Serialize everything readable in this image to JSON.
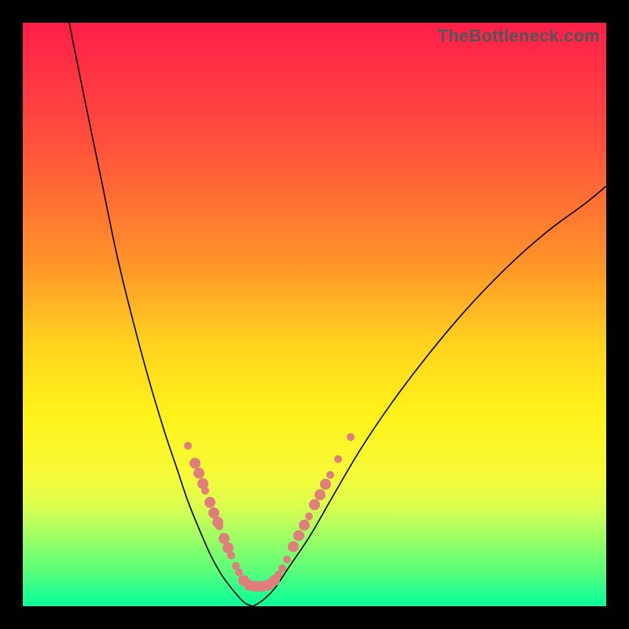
{
  "watermark": "TheBottleneck.com",
  "colors": {
    "background": "#000000",
    "curve": "#000000",
    "marker": "#e07d7d"
  },
  "chart_data": {
    "type": "line",
    "title": "",
    "xlabel": "",
    "ylabel": "",
    "xlim": [
      0,
      742
    ],
    "ylim_visual_percent_from_top": [
      0,
      100
    ],
    "series": [
      {
        "name": "left-branch",
        "x": [
          59,
          80,
          100,
          120,
          140,
          160,
          180,
          195,
          210,
          225,
          238,
          250,
          260,
          272,
          283,
          293
        ],
        "y_percent_from_top": [
          0,
          14,
          27,
          40,
          51,
          61,
          70,
          76,
          82,
          87,
          91,
          94,
          96,
          98,
          99.5,
          100
        ]
      },
      {
        "name": "right-branch",
        "x": [
          293,
          305,
          320,
          340,
          365,
          395,
          430,
          470,
          515,
          565,
          615,
          665,
          715,
          742
        ],
        "y_percent_from_top": [
          100,
          99,
          97,
          93,
          88,
          81,
          73,
          65,
          57,
          49,
          42,
          36,
          31,
          28
        ]
      }
    ],
    "markers": [
      {
        "x": 210,
        "y_percent_from_top": 72.5,
        "r": 5
      },
      {
        "x": 219,
        "y_percent_from_top": 75.5,
        "r": 7
      },
      {
        "x": 224,
        "y_percent_from_top": 77.2,
        "r": 7
      },
      {
        "x": 229,
        "y_percent_from_top": 79.0,
        "r": 7
      },
      {
        "x": 232,
        "y_percent_from_top": 80.2,
        "r": 5
      },
      {
        "x": 238,
        "y_percent_from_top": 82.2,
        "r": 7
      },
      {
        "x": 243,
        "y_percent_from_top": 84.0,
        "r": 7
      },
      {
        "x": 248,
        "y_percent_from_top": 85.6,
        "r": 7
      },
      {
        "x": 250,
        "y_percent_from_top": 86.3,
        "r": 5
      },
      {
        "x": 256,
        "y_percent_from_top": 88.4,
        "r": 7
      },
      {
        "x": 261,
        "y_percent_from_top": 90.0,
        "r": 7
      },
      {
        "x": 265,
        "y_percent_from_top": 91.3,
        "r": 5
      },
      {
        "x": 271,
        "y_percent_from_top": 93.1,
        "r": 5
      },
      {
        "x": 275,
        "y_percent_from_top": 94.2,
        "r": 5
      },
      {
        "x": 281,
        "y_percent_from_top": 95.6,
        "r": 7
      },
      {
        "x": 288,
        "y_percent_from_top": 96.4,
        "r": 7
      },
      {
        "x": 296,
        "y_percent_from_top": 96.6,
        "r": 7
      },
      {
        "x": 304,
        "y_percent_from_top": 96.6,
        "r": 7
      },
      {
        "x": 312,
        "y_percent_from_top": 96.4,
        "r": 7
      },
      {
        "x": 320,
        "y_percent_from_top": 95.6,
        "r": 7
      },
      {
        "x": 325,
        "y_percent_from_top": 94.6,
        "r": 5
      },
      {
        "x": 330,
        "y_percent_from_top": 93.5,
        "r": 5
      },
      {
        "x": 336,
        "y_percent_from_top": 92.0,
        "r": 5
      },
      {
        "x": 344,
        "y_percent_from_top": 89.8,
        "r": 7
      },
      {
        "x": 351,
        "y_percent_from_top": 87.9,
        "r": 7
      },
      {
        "x": 358,
        "y_percent_from_top": 86.1,
        "r": 7
      },
      {
        "x": 364,
        "y_percent_from_top": 84.6,
        "r": 5
      },
      {
        "x": 371,
        "y_percent_from_top": 82.6,
        "r": 7
      },
      {
        "x": 378,
        "y_percent_from_top": 80.9,
        "r": 7
      },
      {
        "x": 385,
        "y_percent_from_top": 79.1,
        "r": 7
      },
      {
        "x": 391,
        "y_percent_from_top": 77.5,
        "r": 5
      },
      {
        "x": 401,
        "y_percent_from_top": 74.8,
        "r": 5
      },
      {
        "x": 417,
        "y_percent_from_top": 71.0,
        "r": 5
      }
    ]
  }
}
